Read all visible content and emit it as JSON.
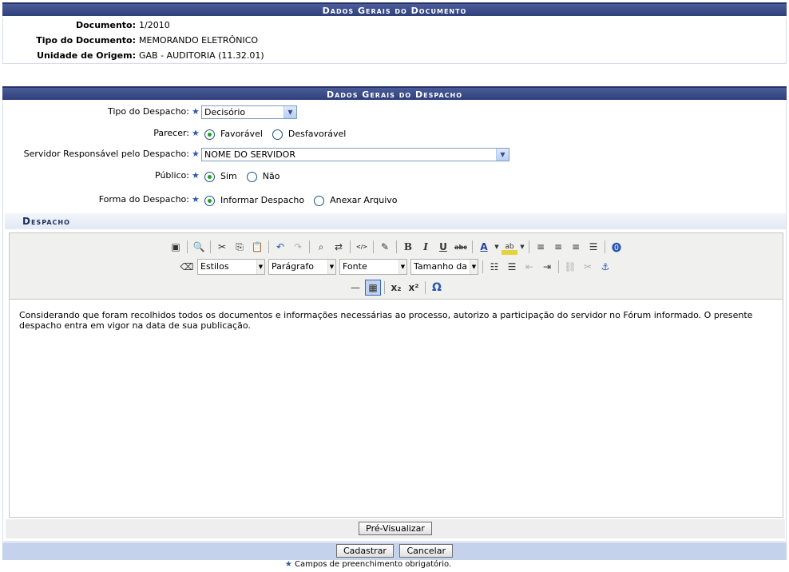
{
  "doc_section": {
    "title": "Dados Gerais do Documento",
    "fields": [
      {
        "label": "Documento:",
        "value": "1/2010"
      },
      {
        "label": "Tipo do Documento:",
        "value": "MEMORANDO ELETRÔNICO"
      },
      {
        "label": "Unidade de Origem:",
        "value": "GAB - AUDITORIA (11.32.01)"
      }
    ]
  },
  "despacho_section": {
    "title": "Dados Gerais do Despacho",
    "tipo": {
      "label": "Tipo do Despacho:",
      "value": "Decisório"
    },
    "parecer": {
      "label": "Parecer:",
      "options": [
        "Favorável",
        "Desfavorável"
      ],
      "selected": "Favorável"
    },
    "servidor": {
      "label": "Servidor Responsável pelo Despacho:",
      "value": "NOME DO SERVIDOR"
    },
    "publico": {
      "label": "Público:",
      "options": [
        "Sim",
        "Não"
      ],
      "selected": "Sim"
    },
    "forma": {
      "label": "Forma do Despacho:",
      "options": [
        "Informar Despacho",
        "Anexar Arquivo"
      ],
      "selected": "Informar Despacho"
    }
  },
  "editor": {
    "heading": "Despacho",
    "selects": {
      "styles": "Estilos",
      "format": "Parágrafo",
      "font": "Fonte",
      "size": "Tamanho da Fo"
    },
    "content": "Considerando que foram recolhidos todos os documentos e informações necessárias ao processo, autorizo a participação do servidor no Fórum informado. O presente despacho entra em vigor na data de sua publicação."
  },
  "buttons": {
    "preview": "Pré-Visualizar",
    "submit": "Cadastrar",
    "cancel": "Cancelar"
  },
  "footnote": "Campos de preenchimento obrigatório.",
  "required_mark": "★",
  "colors": {
    "header": "#2f3f78",
    "star": "#2f58b0",
    "submit_bar": "#c4d2eb"
  }
}
